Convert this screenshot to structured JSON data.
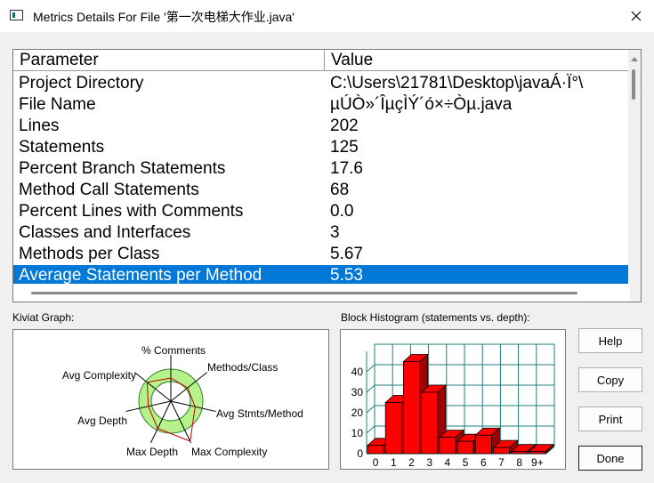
{
  "window": {
    "title": "Metrics Details For File '第一次电梯大作业.java'"
  },
  "table": {
    "columns": [
      "Parameter",
      "Value"
    ],
    "rows": [
      {
        "param": "Project Directory",
        "value": "C:\\Users\\21781\\Desktop\\javaÁ·Ï°\\"
      },
      {
        "param": "File Name",
        "value": "µÚÒ»´ÎµçÌÝ´ó×÷Òµ.java"
      },
      {
        "param": "Lines",
        "value": "202"
      },
      {
        "param": "Statements",
        "value": "125"
      },
      {
        "param": "Percent Branch Statements",
        "value": "17.6"
      },
      {
        "param": "Method Call Statements",
        "value": "68"
      },
      {
        "param": "Percent Lines with Comments",
        "value": "0.0"
      },
      {
        "param": "Classes and Interfaces",
        "value": "3"
      },
      {
        "param": "Methods per Class",
        "value": "5.67"
      },
      {
        "param": "Average Statements per Method",
        "value": "5.53"
      }
    ],
    "selected_index": 9
  },
  "kiviat": {
    "label": "Kiviat Graph:",
    "axes": [
      "% Comments",
      "Methods/Class",
      "Avg Stmts/Method",
      "Max Complexity",
      "Max Depth",
      "Avg Depth",
      "Avg Complexity"
    ],
    "colors": {
      "band": "#b6f18a",
      "band_edge": "#2f7f2f",
      "outline": "#c00000"
    }
  },
  "histogram": {
    "label": "Block Histogram (statements vs. depth):",
    "colors": {
      "bar": "#ff0000",
      "bar_side": "#a00000",
      "grid": "#1f7f7f"
    }
  },
  "chart_data": {
    "type": "bar",
    "title": "Block Histogram (statements vs. depth):",
    "xlabel": "",
    "ylabel": "",
    "categories": [
      "0",
      "1",
      "2",
      "3",
      "4",
      "5",
      "6",
      "7",
      "8",
      "9+"
    ],
    "values": [
      4,
      25,
      45,
      30,
      8,
      6,
      9,
      3,
      1,
      1
    ],
    "ylim": [
      0,
      50
    ],
    "yticks": [
      0,
      10,
      20,
      30,
      40
    ],
    "grid": true
  },
  "buttons": {
    "help": "Help",
    "copy": "Copy",
    "print": "Print",
    "done": "Done"
  }
}
